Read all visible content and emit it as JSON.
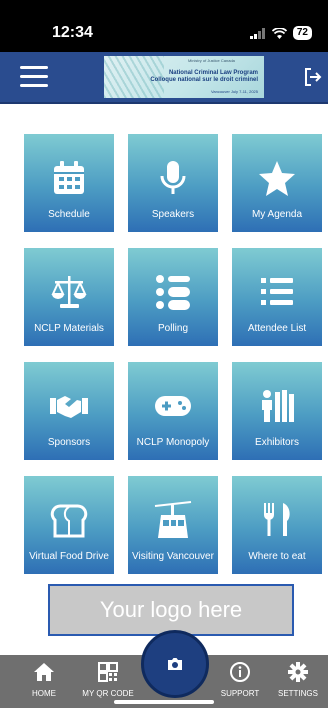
{
  "status": {
    "time": "12:34",
    "battery": "72"
  },
  "banner": {
    "org_text": "Ministry of Justice Canada",
    "title_en": "National Criminal Law Program",
    "title_fr": "Colloque national sur le droit criminel",
    "footer": "Vancouver  July 7-11, 2025"
  },
  "tiles": [
    {
      "label": "Schedule",
      "icon": "calendar-icon"
    },
    {
      "label": "Speakers",
      "icon": "microphone-icon"
    },
    {
      "label": "My Agenda",
      "icon": "star-icon"
    },
    {
      "label": "NCLP Materials",
      "icon": "scales-icon"
    },
    {
      "label": "Polling",
      "icon": "toggles-icon"
    },
    {
      "label": "Attendee List",
      "icon": "list-icon"
    },
    {
      "label": "Sponsors",
      "icon": "handshake-icon"
    },
    {
      "label": "NCLP Monopoly",
      "icon": "gamepad-icon"
    },
    {
      "label": "Exhibitors",
      "icon": "booth-icon"
    },
    {
      "label": "Virtual Food Drive",
      "icon": "bread-icon"
    },
    {
      "label": "Visiting Vancouver",
      "icon": "gondola-icon"
    },
    {
      "label": "Where to eat",
      "icon": "utensils-icon"
    }
  ],
  "logo_placeholder": "Your logo here",
  "bottom_nav": {
    "home": "HOME",
    "qr": "MY QR CODE",
    "support": "SUPPORT",
    "settings": "SETTINGS"
  }
}
